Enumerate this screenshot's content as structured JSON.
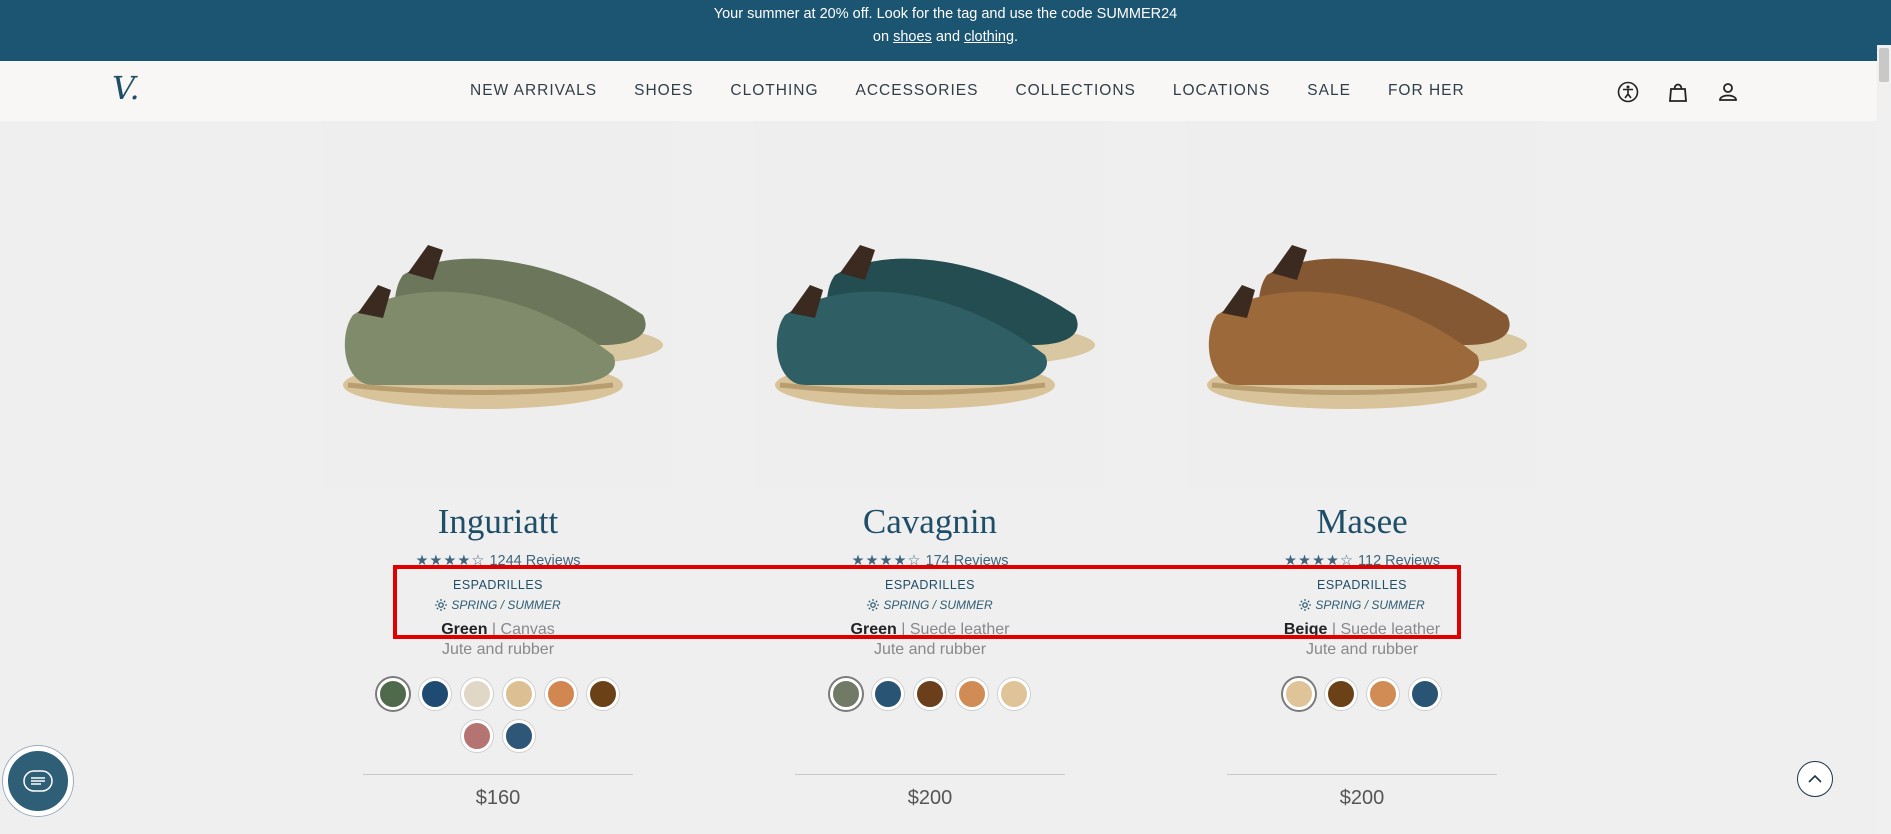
{
  "announcement": {
    "line1": "Your summer at 20% off. Look for the tag and use the code SUMMER24",
    "prefix2": "on",
    "link_shoes": "shoes",
    "and": "and",
    "link_clothing": "clothing",
    "end": "."
  },
  "nav": {
    "logo": "V.",
    "links": [
      "NEW ARRIVALS",
      "SHOES",
      "CLOTHING",
      "ACCESSORIES",
      "COLLECTIONS",
      "LOCATIONS",
      "SALE",
      "FOR HER"
    ],
    "icons": [
      "accessibility-icon",
      "shopping-bag-icon",
      "account-icon"
    ]
  },
  "products": [
    {
      "name": "Inguriatt",
      "stars": "★★★★☆",
      "reviews": "1244 Reviews",
      "category": "ESPADRILLES",
      "season": "SPRING / SUMMER",
      "color": "Green",
      "separator": "|",
      "material": "Canvas",
      "sole": "Jute and rubber",
      "swatches": [
        "#4f6a4a",
        "#1f4b73",
        "#e1d7c6",
        "#dcbf93",
        "#d38750",
        "#6b4218",
        "#b57372",
        "#2e5677"
      ],
      "price": "$160",
      "shoe_upper": "#7f8b6a",
      "shoe_shade": "#6b765a"
    },
    {
      "name": "Cavagnin",
      "stars": "★★★★☆",
      "reviews": "174 Reviews",
      "category": "ESPADRILLES",
      "season": "SPRING / SUMMER",
      "color": "Green",
      "separator": "|",
      "material": "Suede leather",
      "sole": "Jute and rubber",
      "swatches": [
        "#717a66",
        "#2a5473",
        "#6b3f1c",
        "#d08c54",
        "#dfc49a"
      ],
      "price": "$200",
      "shoe_upper": "#2f5f64",
      "shoe_shade": "#244d52"
    },
    {
      "name": "Masee",
      "stars": "★★★★☆",
      "reviews": "112 Reviews",
      "category": "ESPADRILLES",
      "season": "SPRING / SUMMER",
      "color": "Beige",
      "separator": "|",
      "material": "Suede leather",
      "sole": "Jute and rubber",
      "swatches": [
        "#dfc49a",
        "#6b4218",
        "#d08c54",
        "#2a5473"
      ],
      "price": "$200",
      "shoe_upper": "#9c6a3a",
      "shoe_shade": "#845832"
    }
  ],
  "colors": {
    "accent": "#1b5572",
    "highlight": "#e00000"
  }
}
